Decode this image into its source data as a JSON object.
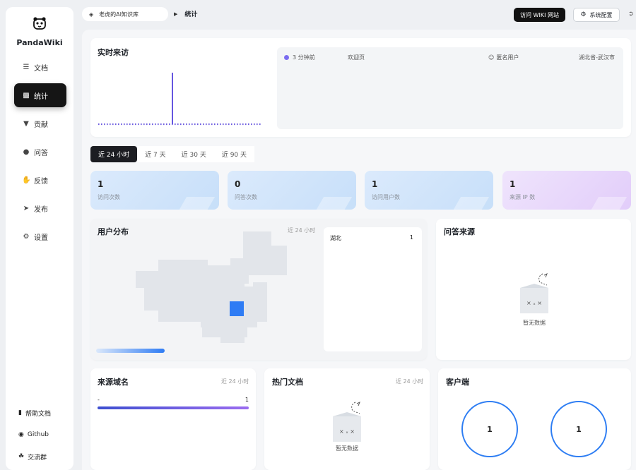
{
  "app": {
    "name": "PandaWiki"
  },
  "sidebar": {
    "items": [
      {
        "label": "文档",
        "icon": "doc-icon"
      },
      {
        "label": "统计",
        "icon": "chart-icon"
      },
      {
        "label": "贡献",
        "icon": "trophy-icon"
      },
      {
        "label": "问答",
        "icon": "chat-icon"
      },
      {
        "label": "反馈",
        "icon": "hand-icon"
      },
      {
        "label": "发布",
        "icon": "send-icon"
      },
      {
        "label": "设置",
        "icon": "gear-icon"
      }
    ],
    "active_index": 1,
    "footer": [
      {
        "label": "帮助文档",
        "icon": "book-icon"
      },
      {
        "label": "Github",
        "icon": "github-icon"
      },
      {
        "label": "交流群",
        "icon": "group-icon"
      }
    ]
  },
  "header": {
    "knowledge_base": "老虎的AI知识库",
    "breadcrumb": "统计",
    "visit_label": "访问 WIKI 网站",
    "config_label": "系统配置"
  },
  "realtime": {
    "title": "实时来访",
    "row": {
      "time": "3 分钟前",
      "page": "欢迎页",
      "user": "匿名用户",
      "location": "湖北省-武汉市"
    }
  },
  "range_tabs": [
    "近 24 小时",
    "近 7 天",
    "近 30 天",
    "近 90 天"
  ],
  "active_range": 0,
  "stats": [
    {
      "value": "1",
      "label": "访问次数"
    },
    {
      "value": "0",
      "label": "问答次数"
    },
    {
      "value": "1",
      "label": "访问用户数"
    },
    {
      "value": "1",
      "label": "来源 IP 数"
    }
  ],
  "user_distribution": {
    "title": "用户分布",
    "range": "近 24 小时",
    "rows": [
      {
        "region": "湖北",
        "count": "1"
      }
    ]
  },
  "qa_source": {
    "title": "问答来源",
    "empty": "暂无数据"
  },
  "source_domains": {
    "title": "来源域名",
    "range": "近 24 小时",
    "rows": [
      {
        "domain": "-",
        "count": "1"
      }
    ]
  },
  "hot_docs": {
    "title": "热门文档",
    "range": "近 24 小时",
    "empty": "暂无数据"
  },
  "clients": {
    "title": "客户端",
    "values": [
      "1",
      "1"
    ]
  },
  "colors": {
    "accent": "#2f7cf4",
    "purple": "#7b6cf0",
    "dark": "#151515"
  }
}
